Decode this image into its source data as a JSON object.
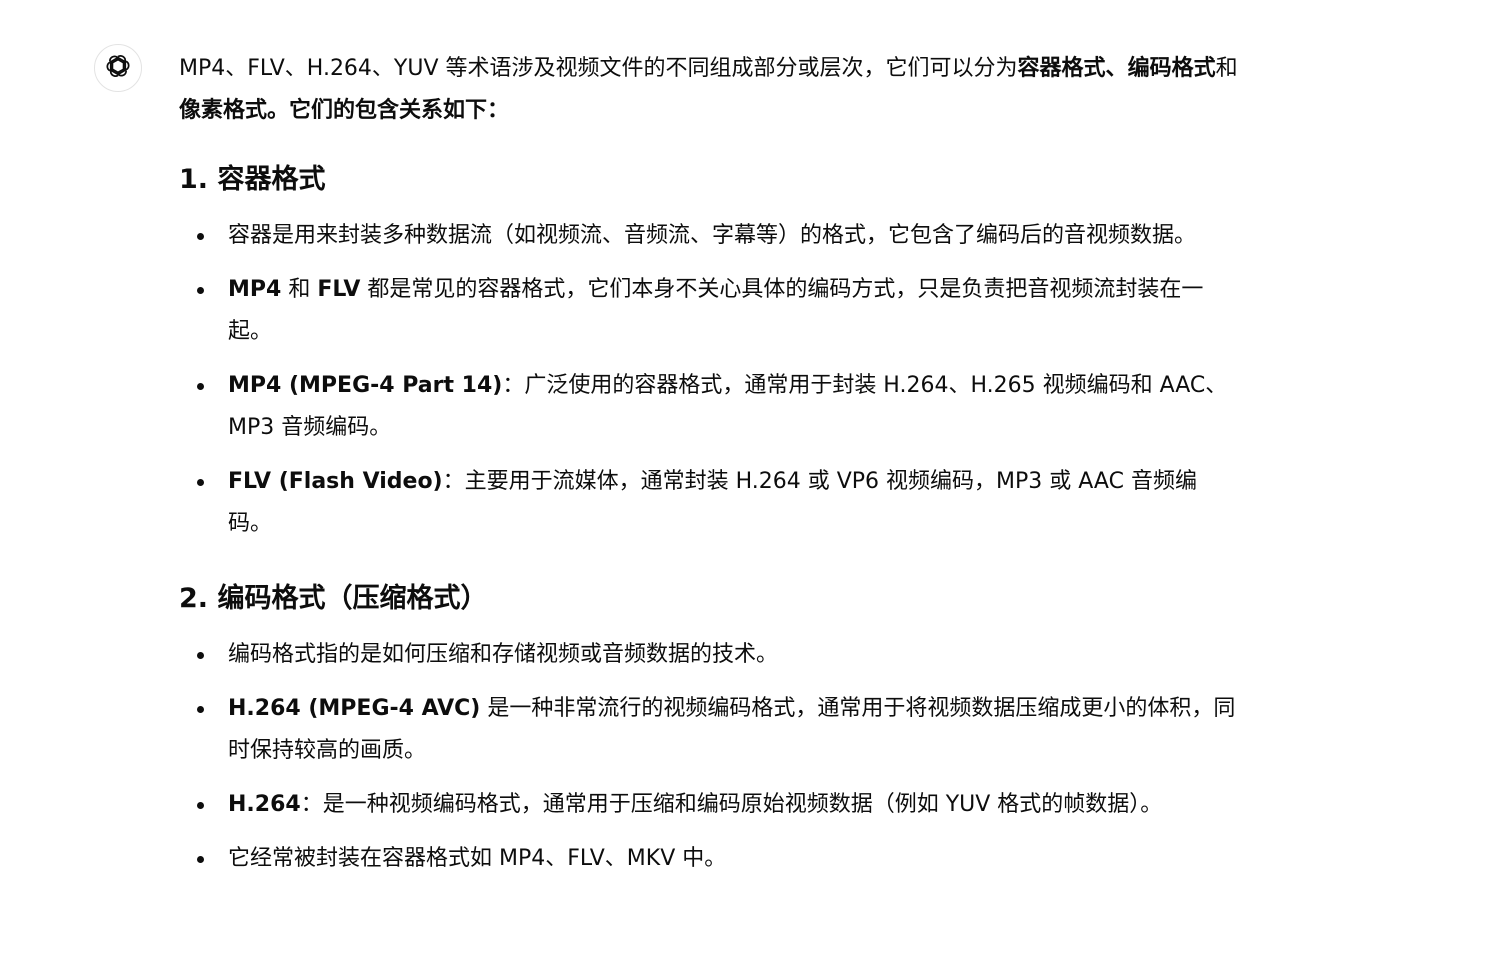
{
  "assistant": {
    "avatar_icon": "openai-logo-icon"
  },
  "intro": {
    "t1": "MP4、FLV、H.264、YUV 等术语涉及视频文件的不同组成部分或层次，它们可以分为",
    "b1": "容器格式",
    "t2": "、",
    "b2": "编码格式",
    "t3": "和",
    "b3": "像素格式",
    "t4": "。它们的包含关系如下："
  },
  "sections": [
    {
      "heading": "1. 容器格式",
      "items": [
        {
          "text": "容器是用来封装多种数据流（如视频流、音频流、字幕等）的格式，它包含了编码后的音视频数据。"
        },
        {
          "b1": "MP4",
          "t1": " 和 ",
          "b2": "FLV",
          "t2": " 都是常见的容器格式，它们本身不关心具体的编码方式，只是负责把音视频流封装在一起。"
        },
        {
          "bold": "MP4 (MPEG-4 Part 14)",
          "text": "：广泛使用的容器格式，通常用于封装 H.264、H.265 视频编码和 AAC、MP3 音频编码。"
        },
        {
          "bold": "FLV (Flash Video)",
          "text": "：主要用于流媒体，通常封装 H.264 或 VP6 视频编码，MP3 或 AAC 音频编码。"
        }
      ]
    },
    {
      "heading": "2. 编码格式（压缩格式）",
      "items": [
        {
          "text": "编码格式指的是如何压缩和存储视频或音频数据的技术。"
        },
        {
          "bold": "H.264 (MPEG-4 AVC)",
          "text": " 是一种非常流行的视频编码格式，通常用于将视频数据压缩成更小的体积，同时保持较高的画质。"
        },
        {
          "bold": "H.264",
          "text": "：是一种视频编码格式，通常用于压缩和编码原始视频数据（例如 YUV 格式的帧数据）。"
        },
        {
          "text": "它经常被封装在容器格式如 MP4、FLV、MKV 中。"
        }
      ]
    }
  ]
}
